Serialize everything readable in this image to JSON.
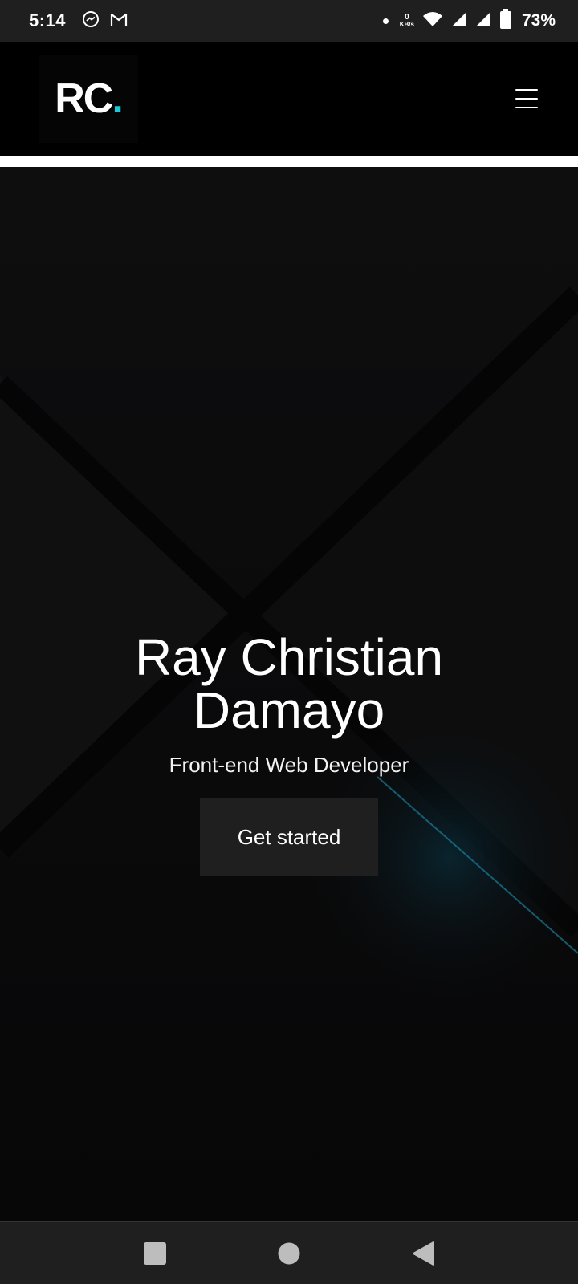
{
  "status_bar": {
    "time": "5:14",
    "net_speed_value": "0",
    "net_speed_unit": "KB/s",
    "battery_percent": "73%",
    "icons": [
      "messenger-icon",
      "gmail-icon",
      "dot-icon",
      "wifi-icon",
      "signal-icon",
      "signal-icon",
      "battery-icon"
    ]
  },
  "header": {
    "logo_text": "RC",
    "logo_dot": ".",
    "logo_dot_color": "#1ec8d8",
    "menu_icon": "hamburger-menu-icon"
  },
  "hero": {
    "title_line1": "Ray Christian",
    "title_line2": "Damayo",
    "subtitle": "Front-end Web Developer",
    "cta_label": "Get started",
    "accent_color": "#1e8fb0"
  },
  "nav_bar": {
    "buttons": [
      "recents-square-icon",
      "home-circle-icon",
      "back-triangle-icon"
    ]
  }
}
